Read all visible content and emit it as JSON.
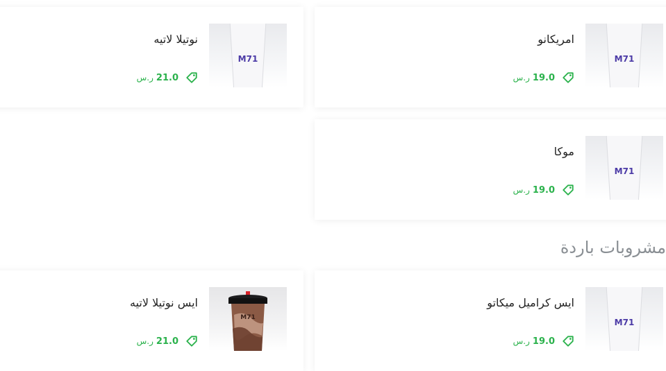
{
  "section_title": "مشروبات باردة",
  "currency": "ر.س",
  "items": [
    {
      "name": "امريكانو",
      "price": "19.0",
      "image": "white-cup-m71"
    },
    {
      "name": "نوتيلا لاتيه",
      "price": "21.0",
      "image": "white-cup-m71"
    },
    {
      "name": "موكا",
      "price": "19.0",
      "image": "white-cup-m71"
    },
    {
      "name": "ايس كراميل ميكاتو",
      "price": "19.0",
      "image": "white-cup-m71"
    },
    {
      "name": "ايس نوتيلا لاتيه",
      "price": "21.0",
      "image": "iced-drink-cup"
    }
  ],
  "colors": {
    "price": "#2bb24c",
    "title": "#8a8f94"
  }
}
